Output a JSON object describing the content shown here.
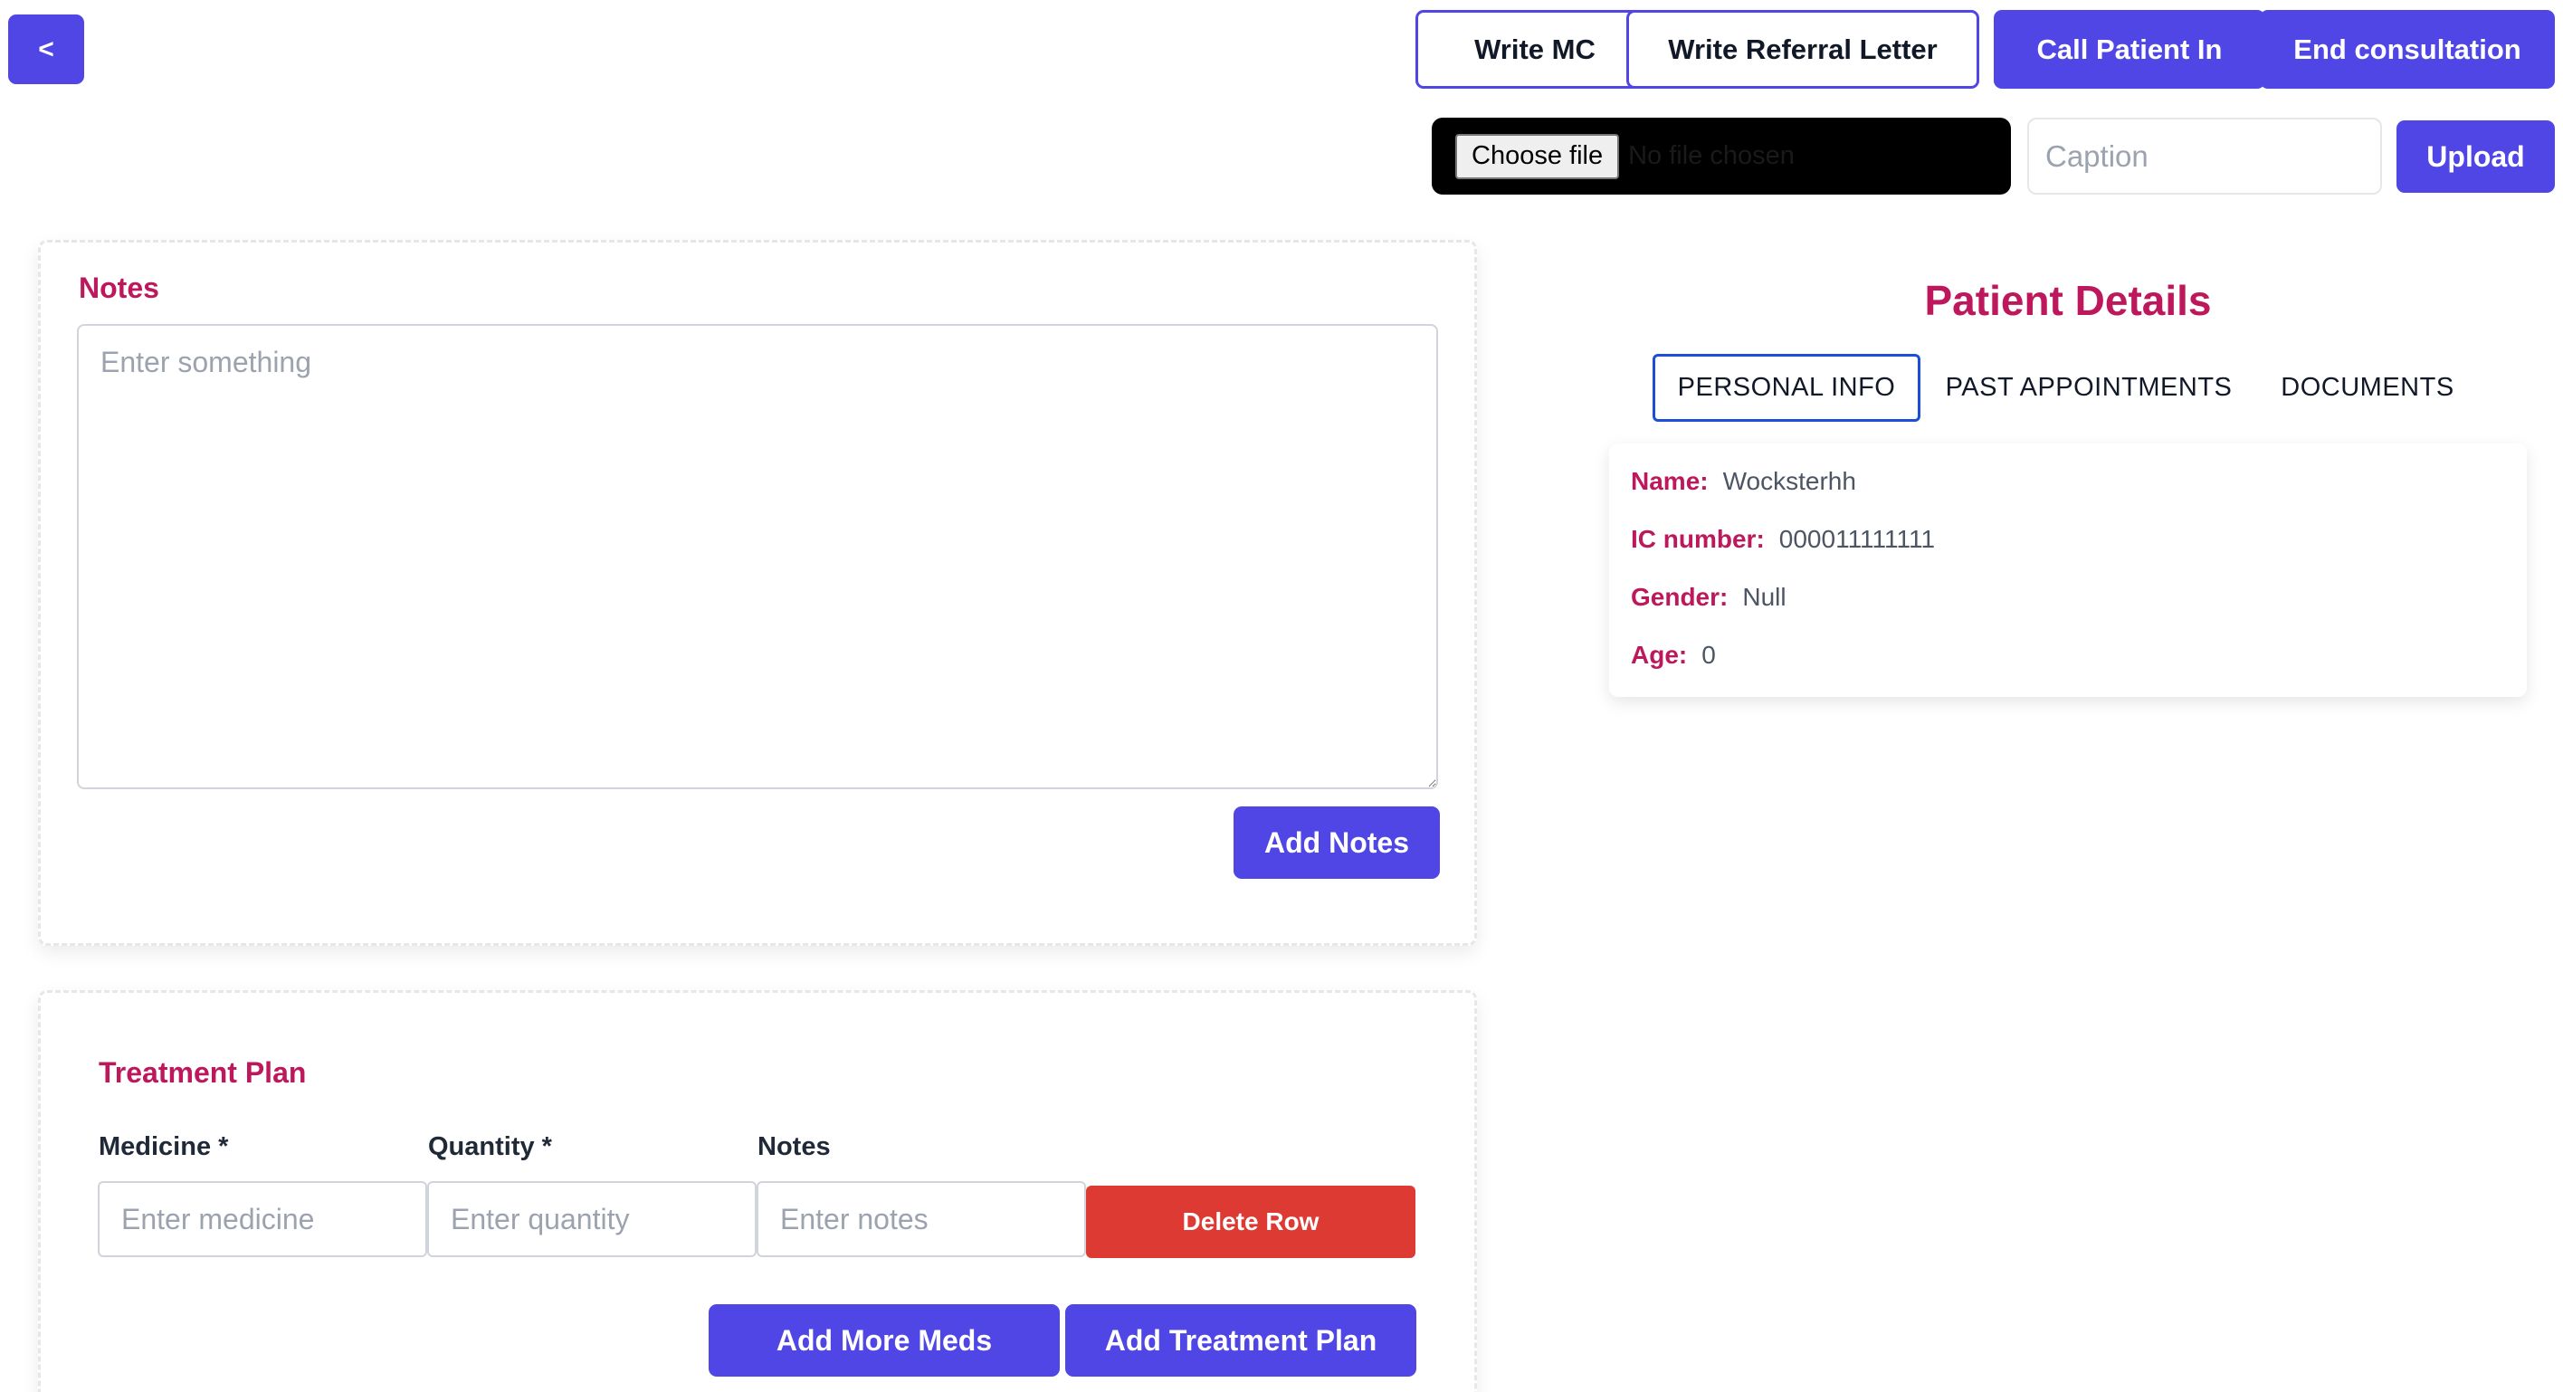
{
  "header": {
    "back_label": "<",
    "write_mc_label": "Write MC",
    "write_referral_label": "Write Referral Letter",
    "call_patient_label": "Call Patient In",
    "end_consultation_label": "End consultation"
  },
  "upload": {
    "choose_file_label": "Choose file",
    "no_file_text": "No file chosen",
    "caption_placeholder": "Caption",
    "upload_label": "Upload"
  },
  "notes": {
    "title": "Notes",
    "placeholder": "Enter something",
    "add_label": "Add Notes"
  },
  "treatment": {
    "title": "Treatment Plan",
    "columns": {
      "medicine": "Medicine *",
      "quantity": "Quantity *",
      "notes": "Notes"
    },
    "row": {
      "medicine_placeholder": "Enter medicine",
      "quantity_placeholder": "Enter quantity",
      "notes_placeholder": "Enter notes",
      "delete_label": "Delete Row"
    },
    "add_more_label": "Add More Meds",
    "add_plan_label": "Add Treatment Plan"
  },
  "patient": {
    "title": "Patient Details",
    "tabs": [
      {
        "label": "PERSONAL INFO",
        "active": true
      },
      {
        "label": "PAST APPOINTMENTS",
        "active": false
      },
      {
        "label": "DOCUMENTS",
        "active": false
      }
    ],
    "details": [
      {
        "label": "Name:",
        "value": "Wocksterhh"
      },
      {
        "label": "IC number:",
        "value": "000011111111"
      },
      {
        "label": "Gender:",
        "value": "Null"
      },
      {
        "label": "Age:",
        "value": "0"
      }
    ]
  },
  "colors": {
    "primary": "#4f46e5",
    "accent_text": "#be185d",
    "danger": "#dc3a32",
    "active_tab_border": "#1d4ed8"
  }
}
